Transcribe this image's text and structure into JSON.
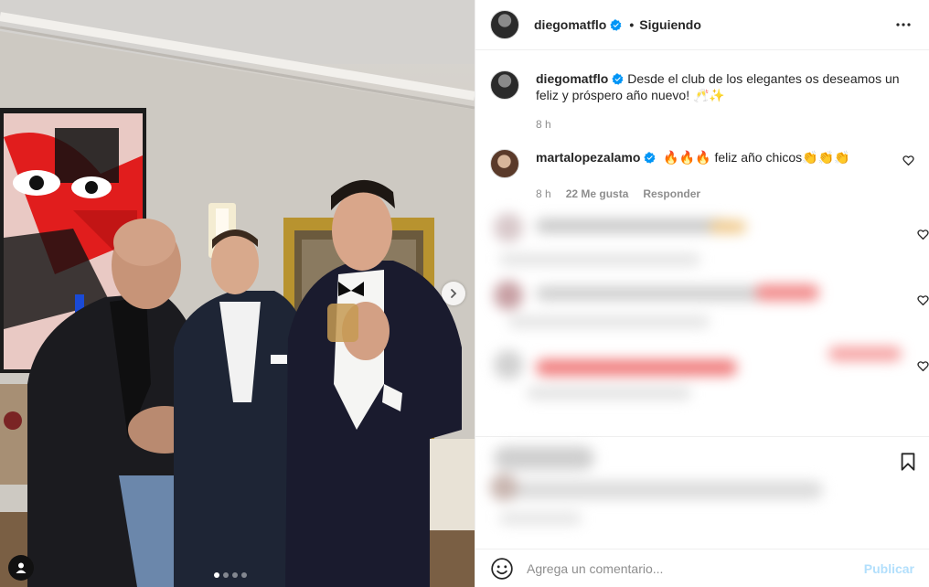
{
  "post": {
    "photo_alt": "",
    "carousel_total": 4,
    "carousel_active": 1
  },
  "header": {
    "username": "diegomatflo",
    "separator": "•",
    "follow_status": "Siguiendo"
  },
  "caption": {
    "username": "diegomatflo",
    "text": "Desde el club de los elegantes os deseamos un feliz y próspero año nuevo! 🥂✨",
    "time": "8 h"
  },
  "comments": [
    {
      "username": "martalopezalamo",
      "text": "🔥🔥🔥 feliz año chicos👏👏👏",
      "time": "8 h",
      "likes": "22 Me gusta",
      "reply": "Responder"
    }
  ],
  "add_comment": {
    "placeholder": "Agrega un comentario...",
    "publish": "Publicar"
  },
  "colors": {
    "verified": "#0095f6",
    "publish_disabled": "#b2dffc",
    "muted": "#8e8e8e"
  },
  "icons": [
    "more-options-icon",
    "verified-badge-icon",
    "heart-icon",
    "bookmark-icon",
    "emoji-icon",
    "chevron-right-icon",
    "tagged-user-icon"
  ]
}
